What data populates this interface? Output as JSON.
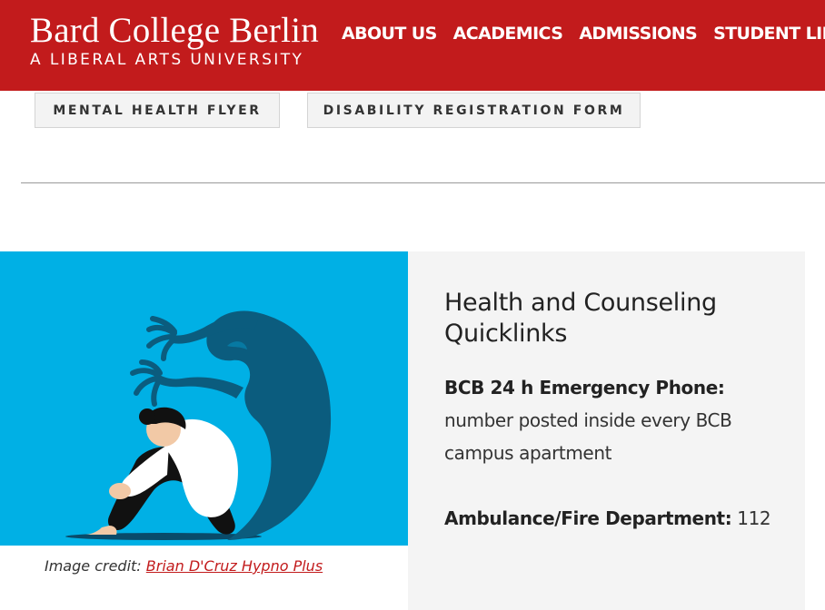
{
  "header": {
    "logo_title": "Bard College Berlin",
    "logo_subtitle": "A LIBERAL ARTS UNIVERSITY",
    "nav": [
      "ABOUT US",
      "ACADEMICS",
      "ADMISSIONS",
      "STUDENT LIFE"
    ],
    "brand_color": "#c21b1c"
  },
  "buttons": {
    "mental_health": "MENTAL HEALTH FLYER",
    "disability": "DISABILITY REGISTRATION FORM"
  },
  "illustration": {
    "subject": "person-with-shadow-monster-illustration",
    "background_color": "#00b0e5"
  },
  "credit": {
    "prefix": "Image credit:",
    "link": "Brian D'Cruz Hypno Plus"
  },
  "panel": {
    "title": "Health and Counseling Quicklinks",
    "emergency_label": "BCB 24 h Emergency Phone:",
    "emergency_text": "number posted inside every BCB campus apartment",
    "ambulance_label": "Ambulance/Fire Department:",
    "ambulance_number": "112"
  }
}
